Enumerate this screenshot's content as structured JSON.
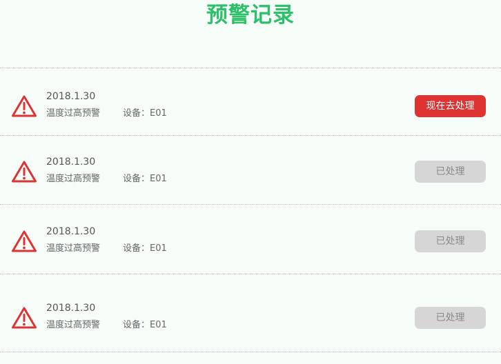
{
  "header": {
    "title": "预警记录"
  },
  "colors": {
    "title": "#2dbf6a",
    "alert": "#dd3333",
    "done_button": "#d6d6d6"
  },
  "records": [
    {
      "icon": "warning-triangle-icon",
      "date": "2018.1.30",
      "description": "温度过高预警",
      "device": "设备：E01",
      "action_label": "现在去处理",
      "status": "pending"
    },
    {
      "icon": "warning-triangle-icon",
      "date": "2018.1.30",
      "description": "温度过高预警",
      "device": "设备：E01",
      "action_label": "已处理",
      "status": "done"
    },
    {
      "icon": "warning-triangle-icon",
      "date": "2018.1.30",
      "description": "温度过高预警",
      "device": "设备：E01",
      "action_label": "已处理",
      "status": "done"
    },
    {
      "icon": "warning-triangle-icon",
      "date": "2018.1.30",
      "description": "温度过高预警",
      "device": "设备：E01",
      "action_label": "已处理",
      "status": "done"
    }
  ]
}
